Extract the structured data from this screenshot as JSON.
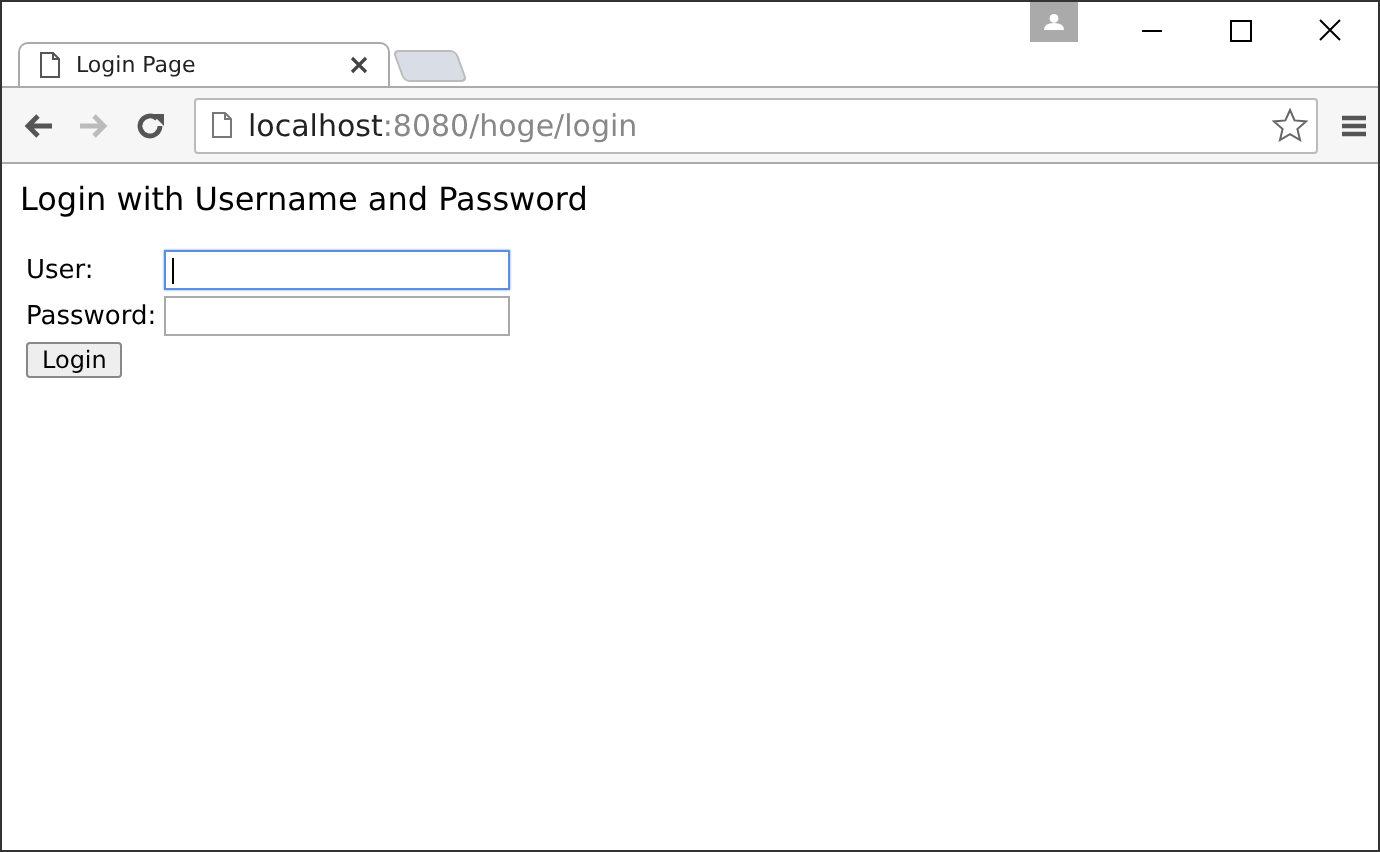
{
  "tabs": [
    {
      "title": "Login Page",
      "selected": true
    }
  ],
  "address_bar": {
    "host": "localhost",
    "path": ":8080/hoge/login"
  },
  "page": {
    "heading": "Login with Username and Password",
    "fields": [
      {
        "label": "User:",
        "focused": true
      },
      {
        "label": "Password:",
        "focused": false
      }
    ],
    "button": "Login"
  }
}
